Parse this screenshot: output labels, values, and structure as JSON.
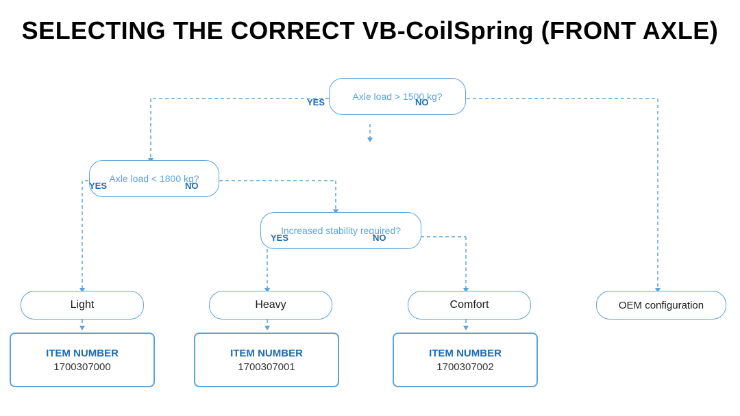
{
  "page": {
    "title": "SELECTING THE CORRECT VB-CoilSpring (FRONT AXLE)"
  },
  "diagram": {
    "decision1": {
      "text": "Axle load > 1500 kg?",
      "yes": "YES",
      "no": "NO"
    },
    "decision2": {
      "text": "Axle load < 1800 kg?",
      "yes": "YES",
      "no": "NO"
    },
    "decision3": {
      "text": "Increased stability required?",
      "yes": "YES",
      "no": "NO"
    },
    "results": {
      "light": "Light",
      "heavy": "Heavy",
      "comfort": "Comfort",
      "oem": "OEM configuration"
    },
    "items": {
      "item1": {
        "label": "ITEM NUMBER",
        "number": "1700307000"
      },
      "item2": {
        "label": "ITEM NUMBER",
        "number": "1700307001"
      },
      "item3": {
        "label": "ITEM NUMBER",
        "number": "1700307002"
      }
    }
  }
}
